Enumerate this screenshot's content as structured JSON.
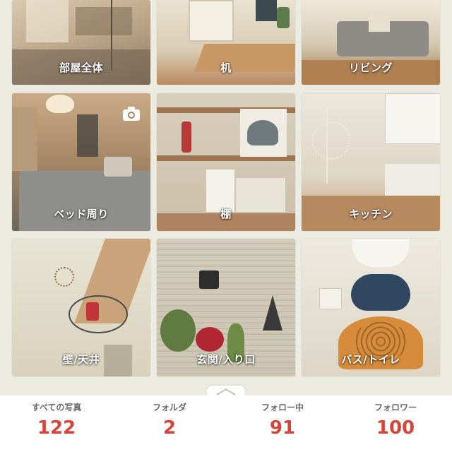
{
  "folders": [
    {
      "label": "部屋全体",
      "theme": "room-overview"
    },
    {
      "label": "机",
      "theme": "desk"
    },
    {
      "label": "リビング",
      "theme": "living"
    },
    {
      "label": "ベッド周り",
      "theme": "bedroom"
    },
    {
      "label": "棚",
      "theme": "shelf"
    },
    {
      "label": "キッチン",
      "theme": "kitchen"
    },
    {
      "label": "壁/天井",
      "theme": "wall-ceiling"
    },
    {
      "label": "玄関/入り口",
      "theme": "entrance"
    },
    {
      "label": "バス/トイレ",
      "theme": "bath-toilet"
    }
  ],
  "camera_icon": "camera-icon",
  "stats": {
    "photos_label": "すべての写真",
    "photos_value": "122",
    "folders_label": "フォルダ",
    "folders_value": "2",
    "following_label": "フォロー中",
    "following_value": "91",
    "followers_label": "フォロワー",
    "followers_value": "100"
  },
  "colors": {
    "stat_value": "#d8443a",
    "background": "#ecebe1"
  },
  "pull_tab_icon": "chevron-up-icon"
}
